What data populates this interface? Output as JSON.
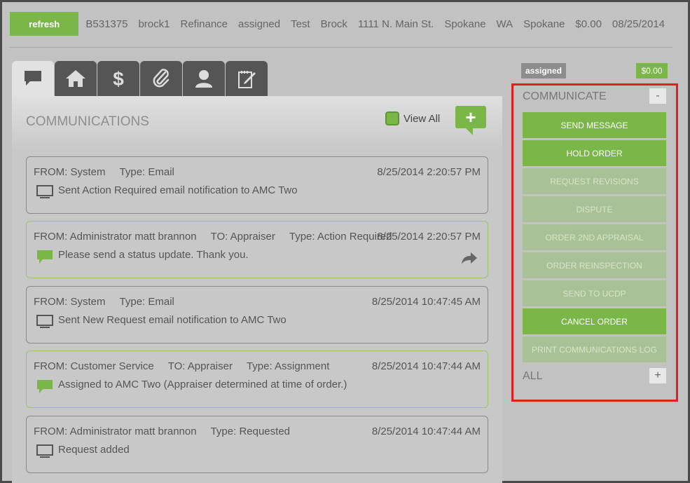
{
  "header": {
    "refresh_label": "refresh",
    "fields": [
      "B531375",
      "brock1",
      "Refinance",
      "assigned",
      "Test",
      "Brock",
      "1111 N. Main St.",
      "Spokane",
      "WA",
      "Spokane",
      "$0.00",
      "08/25/2014"
    ]
  },
  "tabs": [
    {
      "icon": "chat-bubble-icon",
      "active": true
    },
    {
      "icon": "home-icon",
      "active": false
    },
    {
      "icon": "dollar-icon",
      "active": false
    },
    {
      "icon": "paperclip-icon",
      "active": false
    },
    {
      "icon": "person-icon",
      "active": false
    },
    {
      "icon": "notepad-edit-icon",
      "active": false
    }
  ],
  "panel": {
    "title": "COMMUNICATIONS",
    "view_all_label": "View All",
    "add_label": "+"
  },
  "messages": [
    {
      "from": "FROM: System",
      "to": "",
      "type": "Type: Email",
      "date": "8/25/2014 2:20:57 PM",
      "text": "Sent Action Required email notification to AMC Two",
      "icon": "monitor-icon",
      "highlight": false,
      "forward": false
    },
    {
      "from": "FROM: Administrator matt brannon",
      "to": "TO: Appraiser",
      "type": "Type: Action Required",
      "date": "8/25/2014 2:20:57 PM",
      "text": "Please send a status update. Thank you.",
      "icon": "chat-bubble-icon",
      "highlight": true,
      "forward": true
    },
    {
      "from": "FROM: System",
      "to": "",
      "type": "Type: Email",
      "date": "8/25/2014 10:47:45 AM",
      "text": "Sent New Request email notification to AMC Two",
      "icon": "monitor-icon",
      "highlight": false,
      "forward": false
    },
    {
      "from": "FROM: Customer Service",
      "to": "TO: Appraiser",
      "type": "Type: Assignment",
      "date": "8/25/2014 10:47:44 AM",
      "text": "Assigned to AMC Two (Appraiser determined at time of order.)",
      "icon": "chat-bubble-icon",
      "highlight": true,
      "forward": false
    },
    {
      "from": "FROM: Administrator matt brannon",
      "to": "",
      "type": "Type: Requested",
      "date": "8/25/2014 10:47:44 AM",
      "text": "Request added",
      "icon": "monitor-icon",
      "highlight": false,
      "forward": false
    }
  ],
  "side": {
    "status_badge": "assigned",
    "amount_badge": "$0.00",
    "communicate_label": "COMMUNICATE",
    "collapse_label": "-",
    "all_label": "ALL",
    "expand_label": "+",
    "actions": [
      {
        "label": "SEND MESSAGE",
        "enabled": true
      },
      {
        "label": "HOLD ORDER",
        "enabled": true
      },
      {
        "label": "REQUEST REVISIONS",
        "enabled": false
      },
      {
        "label": "DISPUTE",
        "enabled": false
      },
      {
        "label": "ORDER 2ND APPRAISAL",
        "enabled": false
      },
      {
        "label": "ORDER REINSPECTION",
        "enabled": false
      },
      {
        "label": "SEND TO UCDP",
        "enabled": false
      },
      {
        "label": "CANCEL ORDER",
        "enabled": true
      },
      {
        "label": "PRINT COMMUNICATIONS LOG",
        "enabled": false
      }
    ]
  },
  "colors": {
    "accent": "#7ab648",
    "highlight_border": "#e02020",
    "disabled_action": "#a9c196"
  }
}
